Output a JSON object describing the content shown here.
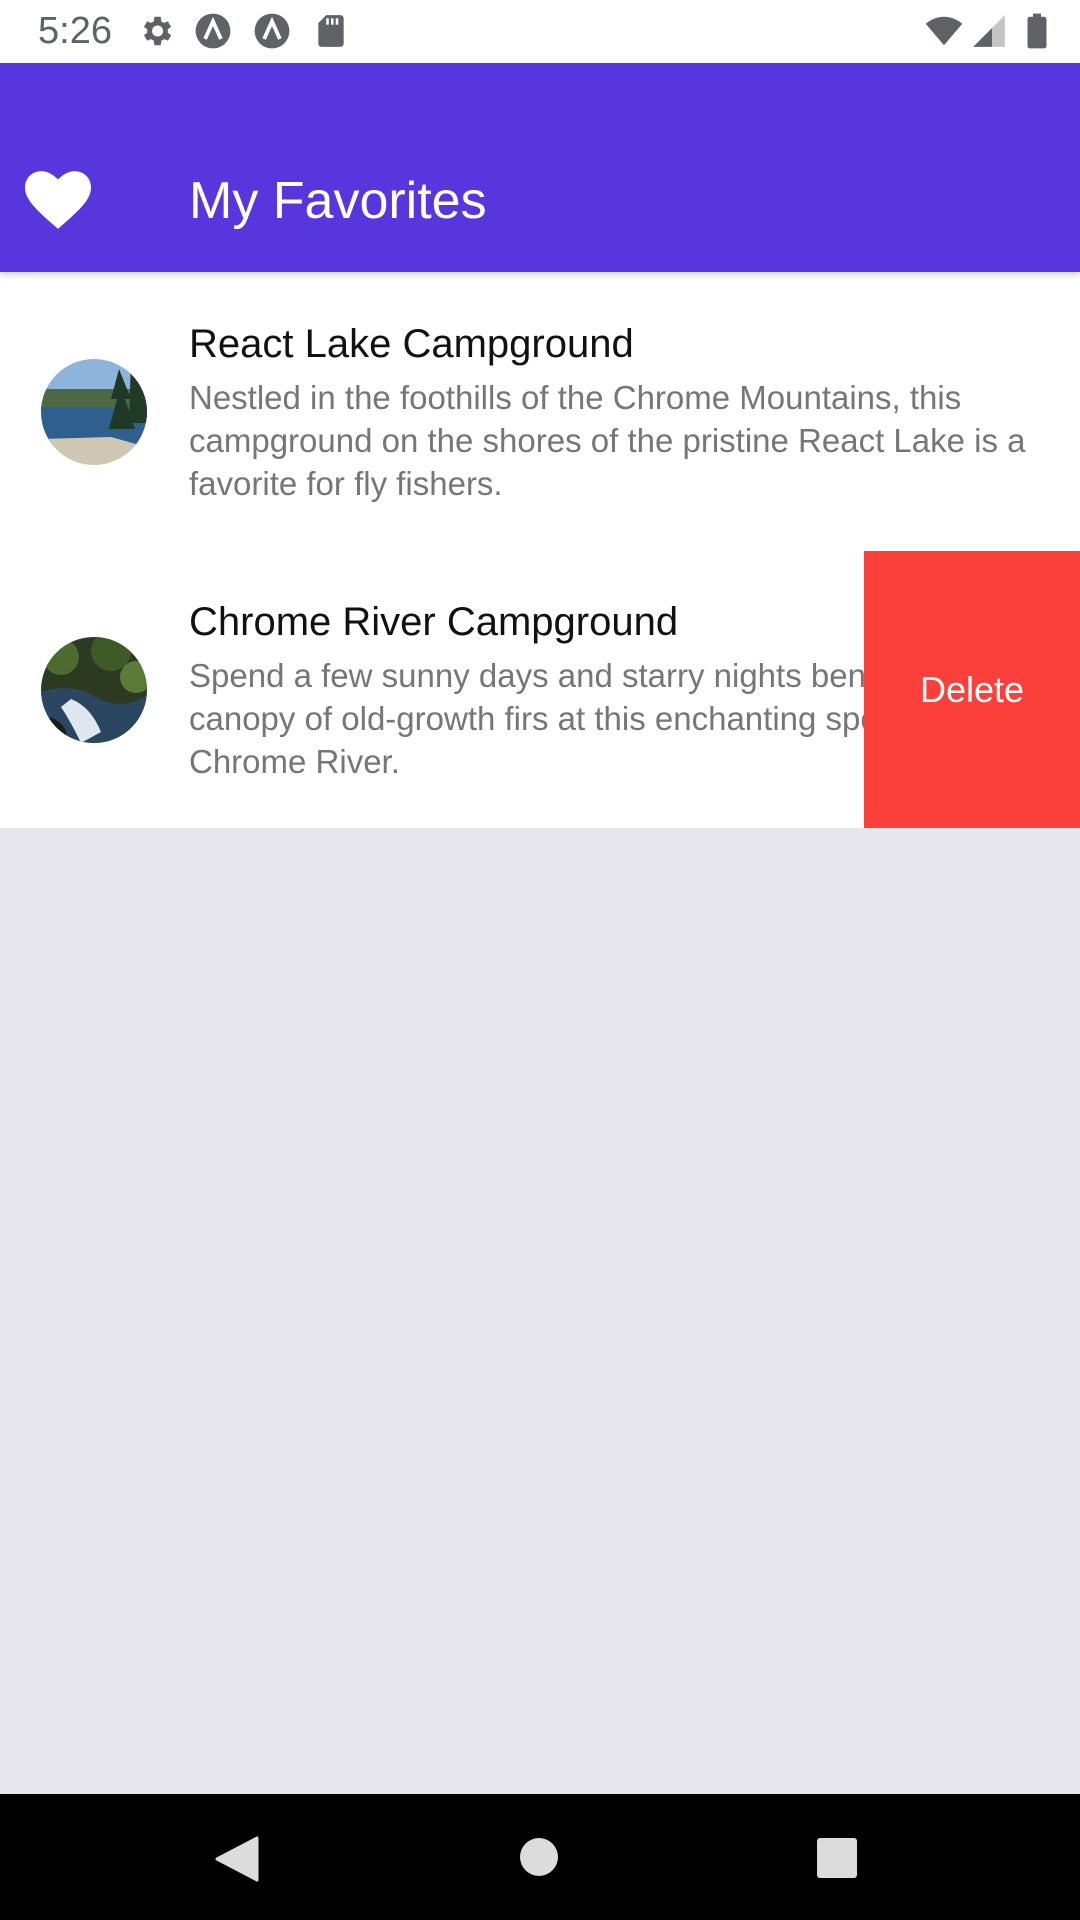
{
  "status_bar": {
    "time": "5:26",
    "icons_left": [
      "gear-icon",
      "react-native-icon",
      "react-native-icon",
      "sd-card-icon"
    ],
    "icons_right": [
      "wifi-icon",
      "cell-signal-icon",
      "battery-icon"
    ]
  },
  "app_bar": {
    "icon": "heart-icon",
    "title": "My Favorites",
    "color": "#5736dd"
  },
  "favorites": [
    {
      "title": "React Lake Campground",
      "description": "Nestled in the foothills of the Chrome Mountains, this campground on the shores of the pristine React Lake is a favorite for fly fishers.",
      "thumbnail": "lake-photo"
    },
    {
      "title": "Chrome River Campground",
      "description": "Spend a few sunny days and starry nights beneath a canopy of old-growth firs at this enchanting spot by the Chrome River.",
      "thumbnail": "river-photo"
    }
  ],
  "swipe_action": {
    "label": "Delete",
    "color": "#fb3f3a"
  },
  "nav_bar": {
    "buttons": [
      "back-icon",
      "home-icon",
      "recents-icon"
    ]
  }
}
